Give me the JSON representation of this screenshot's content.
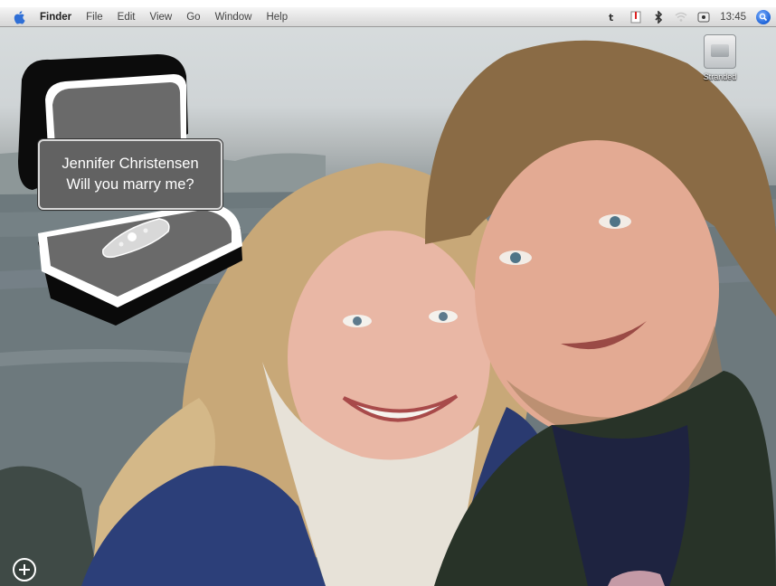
{
  "menubar": {
    "app_name": "Finder",
    "menus": [
      "File",
      "Edit",
      "View",
      "Go",
      "Window",
      "Help"
    ],
    "clock": "13:45",
    "tray_icons": [
      "text-input-icon",
      "document-alert-icon",
      "bluetooth-icon",
      "wifi-icon",
      "volume-icon"
    ]
  },
  "desktop": {
    "drive_label": "Stranded"
  },
  "widget": {
    "name_line": "Jennifer Christensen",
    "question_line": "Will you marry me?"
  },
  "dashboard": {
    "add_button_icon": "plus-circle-icon"
  }
}
